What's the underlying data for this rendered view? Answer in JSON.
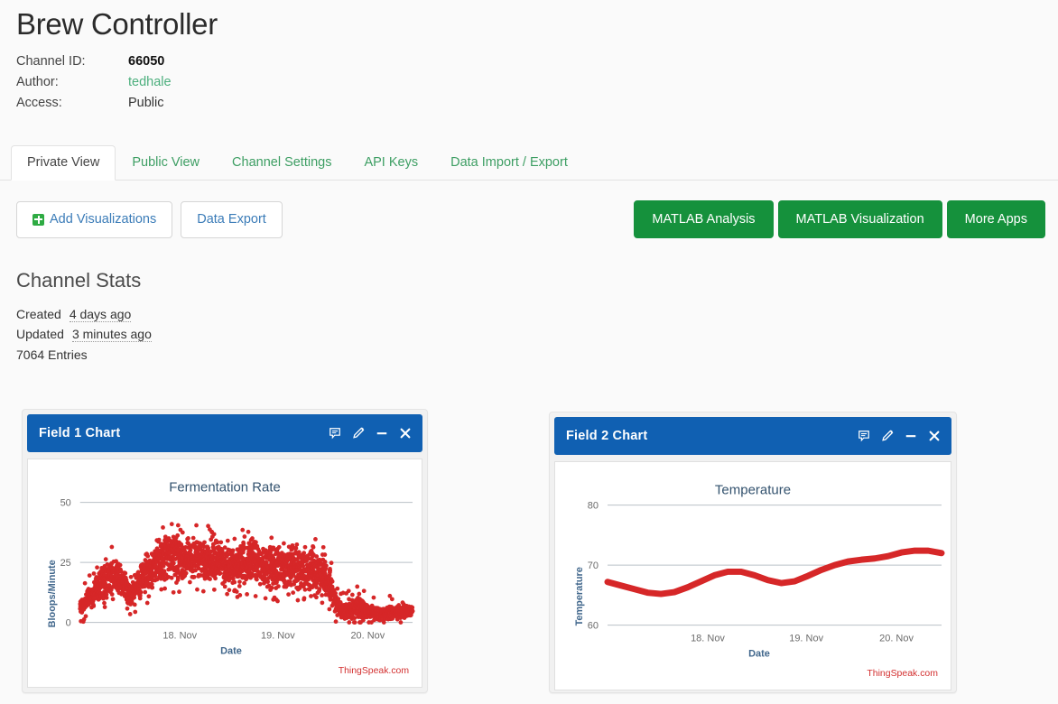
{
  "header": {
    "title": "Brew Controller",
    "meta": [
      {
        "key": "Channel ID:",
        "value": "66050",
        "style": "bold"
      },
      {
        "key": "Author:",
        "value": "tedhale",
        "style": "link"
      },
      {
        "key": "Access:",
        "value": "Public",
        "style": "plain"
      }
    ]
  },
  "tabs": [
    {
      "label": "Private View",
      "active": true
    },
    {
      "label": "Public View",
      "active": false
    },
    {
      "label": "Channel Settings",
      "active": false
    },
    {
      "label": "API Keys",
      "active": false
    },
    {
      "label": "Data Import / Export",
      "active": false
    }
  ],
  "toolbar": {
    "add_visualizations_label": "Add Visualizations",
    "data_export_label": "Data Export",
    "matlab_analysis_label": "MATLAB Analysis",
    "matlab_visualization_label": "MATLAB Visualization",
    "more_apps_label": "More Apps"
  },
  "channel_stats": {
    "section_title": "Channel Stats",
    "created_label": "Created",
    "created_value": "4 days ago",
    "updated_label": "Updated",
    "updated_value": "3 minutes ago",
    "entries": "7064 Entries"
  },
  "panels": [
    {
      "title": "Field 1 Chart",
      "icons": [
        "comment-icon",
        "edit-icon",
        "minimize-icon",
        "close-icon"
      ]
    },
    {
      "title": "Field 2 Chart",
      "icons": [
        "comment-icon",
        "edit-icon",
        "minimize-icon",
        "close-icon"
      ]
    }
  ],
  "colors": {
    "panel_header": "#1060b2",
    "matlab_button": "#15913c",
    "series": "#d62728",
    "author_link": "#4caf7d",
    "tab_link": "#3d9e63"
  },
  "chart_data": [
    {
      "type": "scatter",
      "title": "Fermentation Rate",
      "xlabel": "Date",
      "ylabel": "Bloops/Minute",
      "watermark": "ThingSpeak.com",
      "ylim": [
        0,
        50
      ],
      "yticks": [
        0,
        25,
        50
      ],
      "xticks": [
        "18. Nov",
        "19. Nov",
        "20. Nov"
      ],
      "grid": true,
      "legend": "none",
      "series": [
        {
          "name": "Field 1",
          "color": "#d62728",
          "band": [
            {
              "t": 0.0,
              "lo": 3,
              "hi": 9
            },
            {
              "t": 0.02,
              "lo": 5,
              "hi": 14
            },
            {
              "t": 0.05,
              "lo": 8,
              "hi": 20
            },
            {
              "t": 0.08,
              "lo": 10,
              "hi": 26
            },
            {
              "t": 0.11,
              "lo": 12,
              "hi": 29
            },
            {
              "t": 0.13,
              "lo": 9,
              "hi": 24
            },
            {
              "t": 0.15,
              "lo": 6,
              "hi": 16
            },
            {
              "t": 0.17,
              "lo": 8,
              "hi": 22
            },
            {
              "t": 0.2,
              "lo": 12,
              "hi": 30
            },
            {
              "t": 0.22,
              "lo": 13,
              "hi": 33
            },
            {
              "t": 0.25,
              "lo": 15,
              "hi": 37
            },
            {
              "t": 0.27,
              "lo": 17,
              "hi": 40
            },
            {
              "t": 0.3,
              "lo": 16,
              "hi": 36
            },
            {
              "t": 0.33,
              "lo": 18,
              "hi": 34
            },
            {
              "t": 0.36,
              "lo": 17,
              "hi": 37
            },
            {
              "t": 0.4,
              "lo": 16,
              "hi": 35
            },
            {
              "t": 0.44,
              "lo": 15,
              "hi": 33
            },
            {
              "t": 0.48,
              "lo": 14,
              "hi": 34
            },
            {
              "t": 0.52,
              "lo": 15,
              "hi": 36
            },
            {
              "t": 0.56,
              "lo": 14,
              "hi": 33
            },
            {
              "t": 0.6,
              "lo": 13,
              "hi": 32
            },
            {
              "t": 0.63,
              "lo": 14,
              "hi": 34
            },
            {
              "t": 0.66,
              "lo": 13,
              "hi": 33
            },
            {
              "t": 0.69,
              "lo": 12,
              "hi": 32
            },
            {
              "t": 0.72,
              "lo": 11,
              "hi": 30
            },
            {
              "t": 0.75,
              "lo": 8,
              "hi": 24
            },
            {
              "t": 0.77,
              "lo": 3,
              "hi": 14
            },
            {
              "t": 0.79,
              "lo": 1,
              "hi": 8
            },
            {
              "t": 0.82,
              "lo": 1,
              "hi": 10
            },
            {
              "t": 0.85,
              "lo": 1,
              "hi": 11
            },
            {
              "t": 0.88,
              "lo": 0,
              "hi": 7
            },
            {
              "t": 0.91,
              "lo": 1,
              "hi": 6
            },
            {
              "t": 0.94,
              "lo": 1,
              "hi": 7
            },
            {
              "t": 0.97,
              "lo": 1,
              "hi": 8
            },
            {
              "t": 1.0,
              "lo": 2,
              "hi": 7
            }
          ]
        }
      ]
    },
    {
      "type": "line",
      "title": "Temperature",
      "xlabel": "Date",
      "ylabel": "Temperature",
      "watermark": "ThingSpeak.com",
      "ylim": [
        60,
        80
      ],
      "yticks": [
        60,
        70,
        80
      ],
      "xticks": [
        "18. Nov",
        "19. Nov",
        "20. Nov"
      ],
      "grid": true,
      "legend": "none",
      "series": [
        {
          "name": "Field 2",
          "color": "#d62728",
          "points": [
            {
              "t": 0.0,
              "v": 67.2
            },
            {
              "t": 0.04,
              "v": 66.6
            },
            {
              "t": 0.08,
              "v": 66.0
            },
            {
              "t": 0.12,
              "v": 65.4
            },
            {
              "t": 0.16,
              "v": 65.2
            },
            {
              "t": 0.2,
              "v": 65.5
            },
            {
              "t": 0.24,
              "v": 66.3
            },
            {
              "t": 0.28,
              "v": 67.3
            },
            {
              "t": 0.32,
              "v": 68.3
            },
            {
              "t": 0.36,
              "v": 68.9
            },
            {
              "t": 0.4,
              "v": 68.9
            },
            {
              "t": 0.44,
              "v": 68.3
            },
            {
              "t": 0.48,
              "v": 67.5
            },
            {
              "t": 0.52,
              "v": 67.0
            },
            {
              "t": 0.56,
              "v": 67.3
            },
            {
              "t": 0.6,
              "v": 68.2
            },
            {
              "t": 0.64,
              "v": 69.2
            },
            {
              "t": 0.68,
              "v": 70.0
            },
            {
              "t": 0.72,
              "v": 70.6
            },
            {
              "t": 0.76,
              "v": 70.9
            },
            {
              "t": 0.8,
              "v": 71.1
            },
            {
              "t": 0.84,
              "v": 71.5
            },
            {
              "t": 0.88,
              "v": 72.1
            },
            {
              "t": 0.92,
              "v": 72.4
            },
            {
              "t": 0.96,
              "v": 72.4
            },
            {
              "t": 1.0,
              "v": 72.0
            }
          ]
        }
      ]
    }
  ]
}
